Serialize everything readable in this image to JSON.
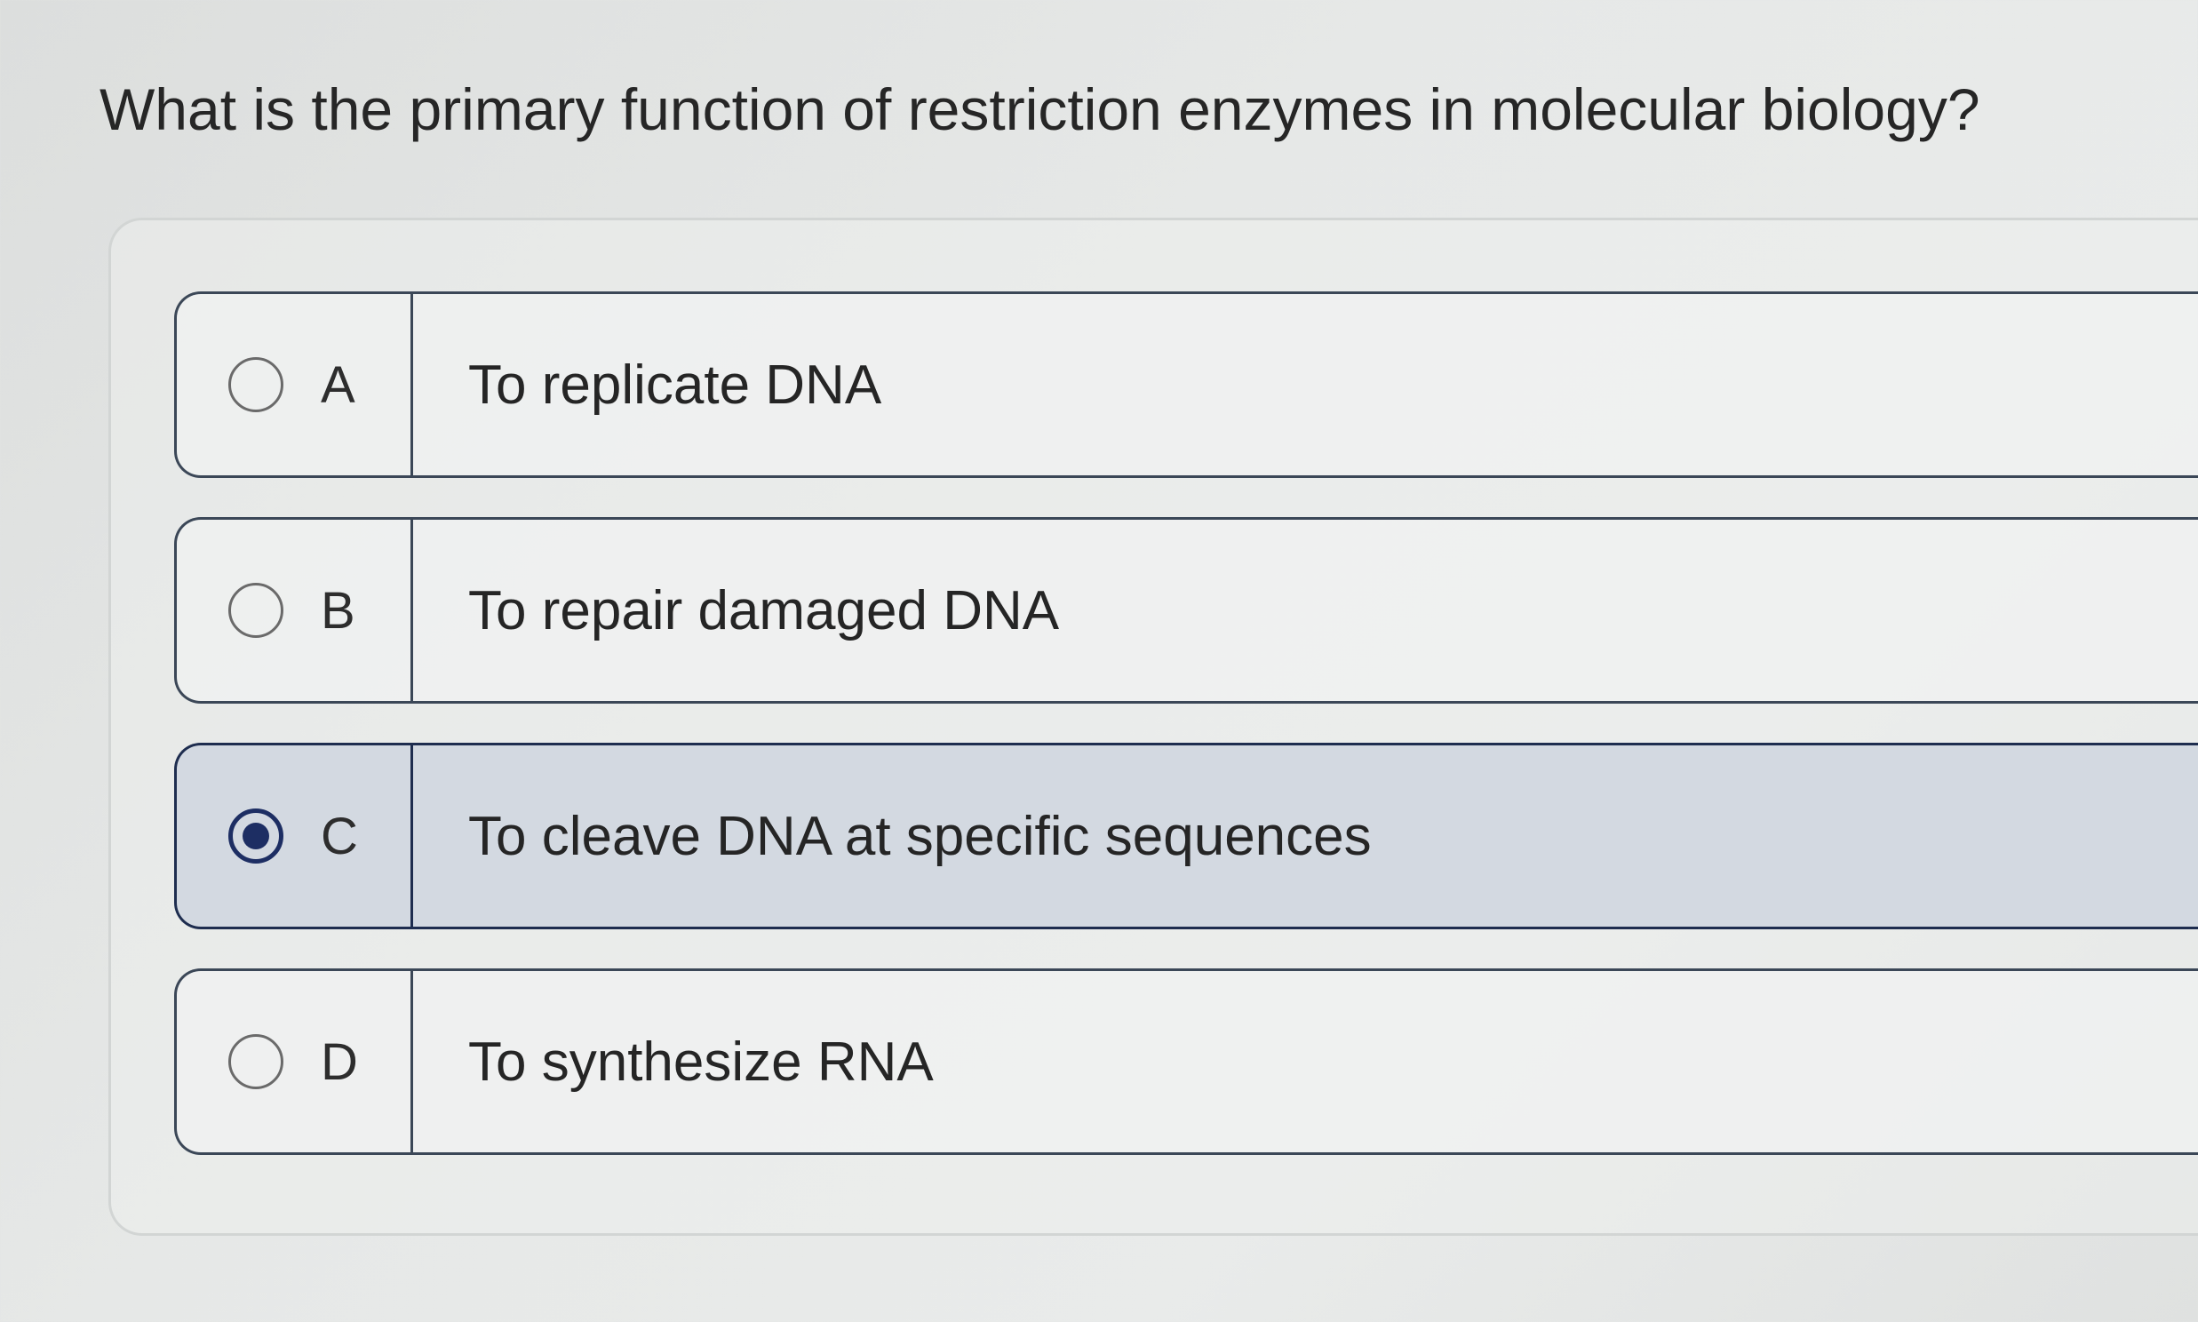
{
  "question": {
    "text": "What is the primary function of restriction enzymes in molecular biology?"
  },
  "options": [
    {
      "letter": "A",
      "text": "To replicate DNA",
      "selected": false
    },
    {
      "letter": "B",
      "text": "To repair damaged DNA",
      "selected": false
    },
    {
      "letter": "C",
      "text": "To cleave DNA at specific sequences",
      "selected": true
    },
    {
      "letter": "D",
      "text": "To synthesize RNA",
      "selected": false
    }
  ],
  "colors": {
    "selected_accent": "#1d2e63",
    "selected_background": "#d3d9e1",
    "border": "#3b4757"
  }
}
